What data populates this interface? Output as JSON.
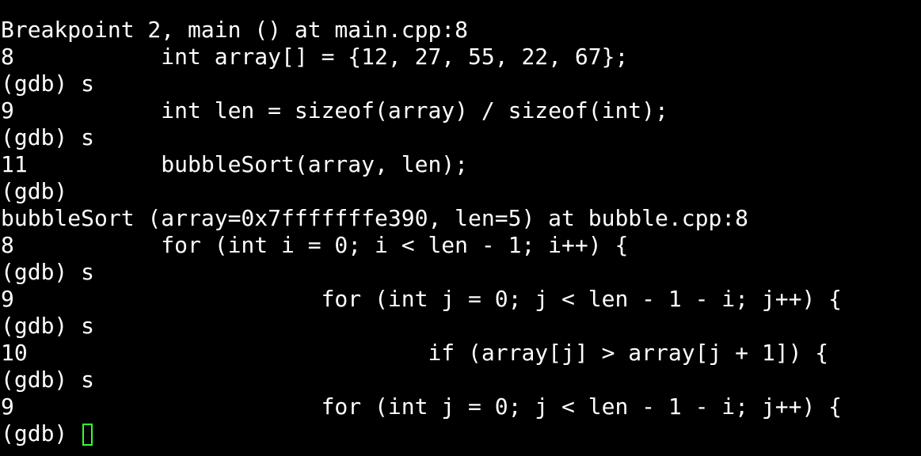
{
  "terminal": {
    "lines": [
      "Breakpoint 2, main () at main.cpp:8",
      "8           int array[] = {12, 27, 55, 22, 67};",
      "(gdb) s",
      "9           int len = sizeof(array) / sizeof(int);",
      "(gdb) s",
      "11          bubbleSort(array, len);",
      "(gdb)",
      "bubbleSort (array=0x7fffffffe390, len=5) at bubble.cpp:8",
      "8           for (int i = 0; i < len - 1; i++) {",
      "(gdb) s",
      "9                       for (int j = 0; j < len - 1 - i; j++) {",
      "(gdb) s",
      "10                              if (array[j] > array[j + 1]) {",
      "(gdb) s",
      "9                       for (int j = 0; j < len - 1 - i; j++) {"
    ],
    "prompt": "(gdb) ",
    "cursor_color": "#33ff33",
    "background": "#000000",
    "foreground": "#ffffff"
  }
}
